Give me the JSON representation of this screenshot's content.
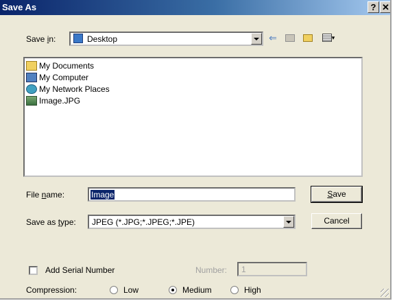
{
  "window": {
    "title": "Save As",
    "help_label": "?",
    "close_label": "✕"
  },
  "save_in": {
    "label_prefix": "Save ",
    "label_underlined": "i",
    "label_suffix": "n:",
    "value": "Desktop"
  },
  "toolbar": {
    "icons": [
      "back-arrow-icon",
      "up-folder-icon",
      "new-folder-icon",
      "view-menu-icon"
    ]
  },
  "files": [
    {
      "name": "My Documents",
      "icon": "folder-icon"
    },
    {
      "name": "My Computer",
      "icon": "computer-icon"
    },
    {
      "name": "My Network Places",
      "icon": "network-icon"
    },
    {
      "name": "Image.JPG",
      "icon": "image-file-icon"
    }
  ],
  "file_name": {
    "label_prefix": "File ",
    "label_underlined": "n",
    "label_suffix": "ame:",
    "value": "Image"
  },
  "save_as_type": {
    "label_prefix": "Save as ",
    "label_underlined": "t",
    "label_suffix": "ype:",
    "value": "JPEG (*.JPG;*.JPEG;*.JPE)"
  },
  "buttons": {
    "save_underlined": "S",
    "save_rest": "ave",
    "cancel": "Cancel"
  },
  "options": {
    "serial_label": "Add Serial Number",
    "serial_checked": false,
    "number_label": "Number:",
    "number_value": "1",
    "compression_label": "Compression:",
    "compression_options": [
      "Low",
      "Medium",
      "High"
    ],
    "compression_selected": "Medium"
  }
}
